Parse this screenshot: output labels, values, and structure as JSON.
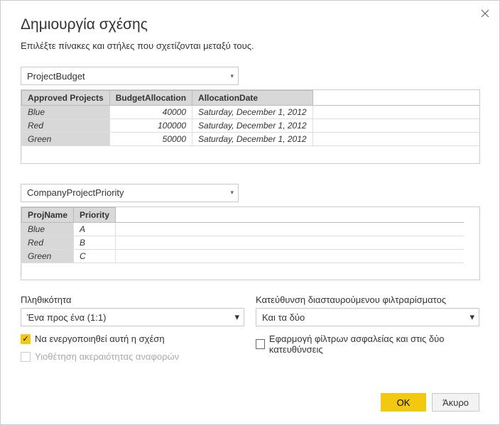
{
  "dialog": {
    "title": "Δημιουργία σχέσης",
    "subtitle": "Επιλέξτε πίνακες και στήλες που σχετίζονται μεταξύ τους."
  },
  "table1": {
    "dropdown": "ProjectBudget",
    "headers": [
      "Approved Projects",
      "BudgetAllocation",
      "AllocationDate"
    ],
    "rows": [
      {
        "c0": "Blue",
        "c1": "40000",
        "c2": "Saturday, December 1, 2012"
      },
      {
        "c0": "Red",
        "c1": "100000",
        "c2": "Saturday, December 1, 2012"
      },
      {
        "c0": "Green",
        "c1": "50000",
        "c2": "Saturday, December 1, 2012"
      }
    ]
  },
  "table2": {
    "dropdown": "CompanyProjectPriority",
    "headers": [
      "ProjName",
      "Priority"
    ],
    "rows": [
      {
        "c0": "Blue",
        "c1": "A"
      },
      {
        "c0": "Red",
        "c1": "B"
      },
      {
        "c0": "Green",
        "c1": "C"
      }
    ]
  },
  "cardinality": {
    "label": "Πληθικότητα",
    "value": "Ένα προς ένα (1:1)"
  },
  "crossfilter": {
    "label": "Κατεύθυνση διασταυρούμενου φιλτραρίσματος",
    "value": "Και τα δύο"
  },
  "check_activate": "Να ενεργοποιηθεί αυτή η σχέση",
  "check_security": "Εφαρμογή φίλτρων ασφαλείας και στις δύο κατευθύνσεις",
  "check_integrity": "Υιοθέτηση ακεραιότητας αναφορών",
  "buttons": {
    "ok": "OK",
    "cancel": "Άκυρο"
  }
}
